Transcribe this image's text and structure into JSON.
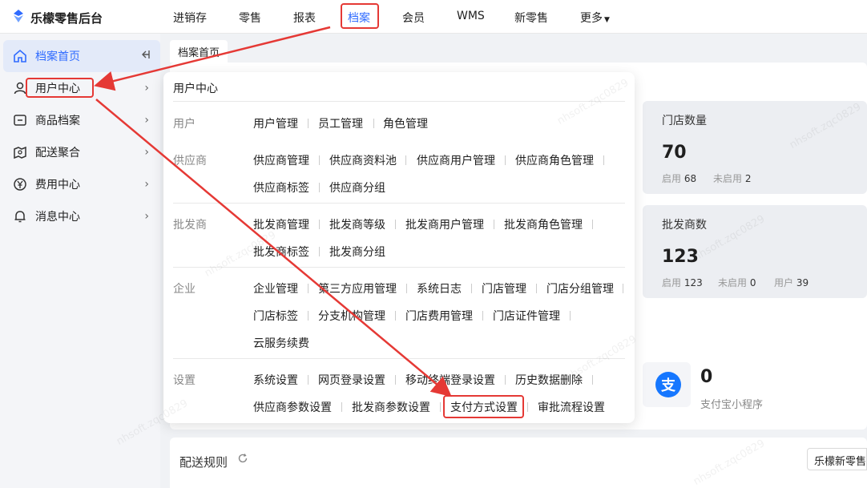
{
  "app": {
    "title": "乐檬零售后台"
  },
  "topnav": [
    "进销存",
    "零售",
    "报表",
    "档案",
    "会员",
    "WMS",
    "新零售",
    "更多"
  ],
  "topnav_active": "档案",
  "sidebar": {
    "items": [
      {
        "label": "档案首页",
        "icon": "home-icon",
        "active": true
      },
      {
        "label": "用户中心",
        "icon": "user-icon"
      },
      {
        "label": "商品档案",
        "icon": "box-icon"
      },
      {
        "label": "配送聚合",
        "icon": "delivery-icon"
      },
      {
        "label": "费用中心",
        "icon": "yen-icon"
      },
      {
        "label": "消息中心",
        "icon": "bell-icon"
      }
    ],
    "collapse_icon": "collapse-icon",
    "chevron": "›"
  },
  "tab": {
    "label": "档案首页"
  },
  "stats": {
    "stores": {
      "title": "门店数量",
      "value": "70",
      "enabled_label": "启用",
      "enabled": "68",
      "disabled_label": "未启用",
      "disabled": "2"
    },
    "wholesalers": {
      "title": "批发商数",
      "value": "123",
      "enabled_label": "启用",
      "enabled": "123",
      "disabled_label": "未启用",
      "disabled": "0",
      "user_label": "用户",
      "user": "39"
    },
    "alipay": {
      "value": "0",
      "label": "支付宝小程序",
      "icon": "alipay-icon",
      "brand_color": "#1677ff"
    }
  },
  "panel": {
    "title": "用户中心",
    "groups": [
      {
        "label": "用户",
        "links": [
          "用户管理",
          "员工管理",
          "角色管理"
        ]
      },
      {
        "label": "供应商",
        "links": [
          "供应商管理",
          "供应商资料池",
          "供应商用户管理",
          "供应商角色管理",
          "供应商标签",
          "供应商分组"
        ]
      },
      {
        "label": "批发商",
        "links": [
          "批发商管理",
          "批发商等级",
          "批发商用户管理",
          "批发商角色管理",
          "批发商标签",
          "批发商分组"
        ]
      },
      {
        "label": "企业",
        "links": [
          "企业管理",
          "第三方应用管理",
          "系统日志",
          "门店管理",
          "门店分组管理",
          "门店标签",
          "分支机构管理",
          "门店费用管理",
          "门店证件管理",
          "云服务续费"
        ]
      },
      {
        "label": "设置",
        "links": [
          "系统设置",
          "网页登录设置",
          "移动终端登录设置",
          "历史数据删除",
          "供应商参数设置",
          "批发商参数设置",
          "支付方式设置",
          "审批流程设置"
        ]
      }
    ]
  },
  "bottom": {
    "title": "配送规则",
    "refresh_icon": "refresh-icon",
    "right_button": "乐檬新零售"
  },
  "watermark": "nhsoft.zqc0829",
  "colors": {
    "accent": "#2f6bff",
    "highlight": "#e53935",
    "sidebar_bg": "#f4f5f8",
    "sidebar_active": "#e3eaf9"
  }
}
